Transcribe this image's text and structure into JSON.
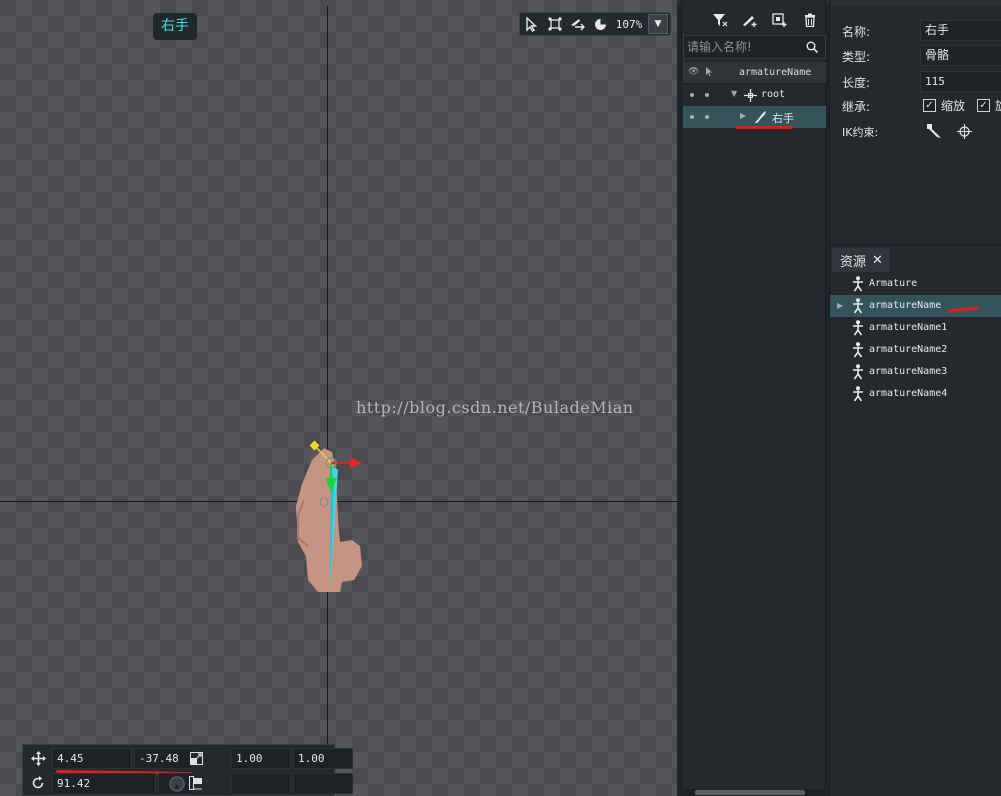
{
  "viewport": {
    "bone_tag": "右手",
    "zoom": "107%",
    "watermark": "http://blog.csdn.net/BuladeMian",
    "tools": [
      "select-icon",
      "transform-icon",
      "bone-tool-icon",
      "onion-skin-icon"
    ]
  },
  "transform": {
    "pos_x": "4.45",
    "pos_y": "-37.48",
    "scale_x": "1.00",
    "scale_y": "1.00",
    "rotation": "91.42"
  },
  "hierarchy": {
    "search_placeholder": "请输入名称!",
    "header_title": "armatureName",
    "items": [
      {
        "label": "root",
        "depth": 1
      },
      {
        "label": "右手",
        "depth": 2,
        "selected": true
      }
    ]
  },
  "properties": {
    "name_label": "名称:",
    "name_value": "右手",
    "type_label": "类型:",
    "type_value": "骨骼",
    "length_label": "长度:",
    "length_value": "115",
    "inherit_label": "继承:",
    "inherit_scale": "缩放",
    "inherit_rotate": "旋",
    "ik_label": "IK约束:"
  },
  "resources": {
    "tab_label": "资源",
    "items": [
      "Armature",
      "armatureName",
      "armatureName1",
      "armatureName2",
      "armatureName3",
      "armatureName4"
    ],
    "selected_index": 1
  },
  "colors": {
    "accent_cyan": "#3fe0e0",
    "selection": "#33545a",
    "annotation_red": "#e01c1c"
  }
}
